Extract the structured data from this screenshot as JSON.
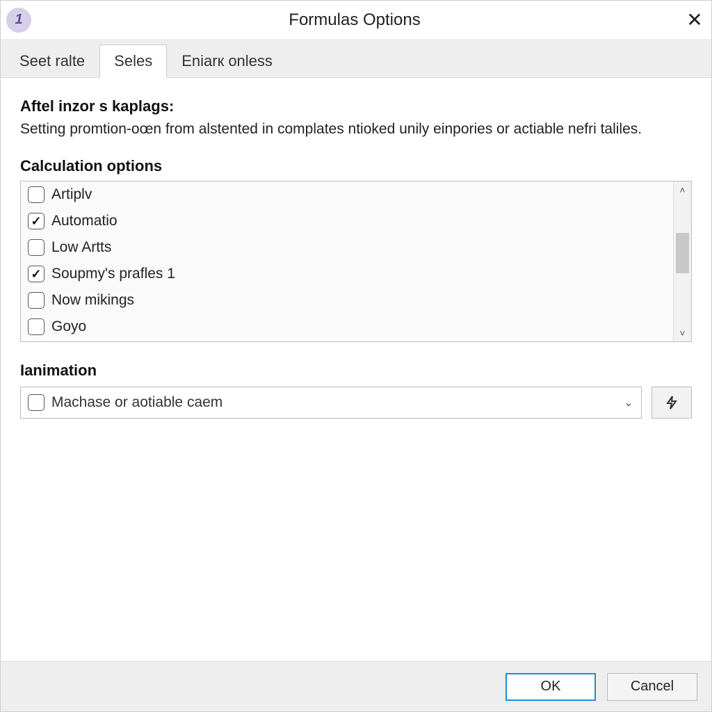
{
  "window": {
    "title": "Formulas Options",
    "icon_glyph": "1"
  },
  "tabs": [
    {
      "label": "Seet ralte",
      "active": false
    },
    {
      "label": "Seles",
      "active": true
    },
    {
      "label": "Eniarк onless",
      "active": false
    }
  ],
  "intro": {
    "heading": "Aftel inzor s kaplags:",
    "body": "Setting promtion-oœn from alstented in complates ntioked unily einpories or actiable nefri taliles."
  },
  "calc": {
    "heading": "Calculation options",
    "items": [
      {
        "label": "Artiplv",
        "checked": false
      },
      {
        "label": "Automatio",
        "checked": true
      },
      {
        "label": "Low Artts",
        "checked": false
      },
      {
        "label": "Soupmy's prafles 1",
        "checked": true
      },
      {
        "label": "Now mikings",
        "checked": false
      },
      {
        "label": "Goyo",
        "checked": false
      }
    ]
  },
  "anim": {
    "heading": "Ianimation",
    "combo_value": "Machase or aotiable caem",
    "combo_checked": false
  },
  "footer": {
    "ok": "OK",
    "cancel": "Cancel"
  }
}
